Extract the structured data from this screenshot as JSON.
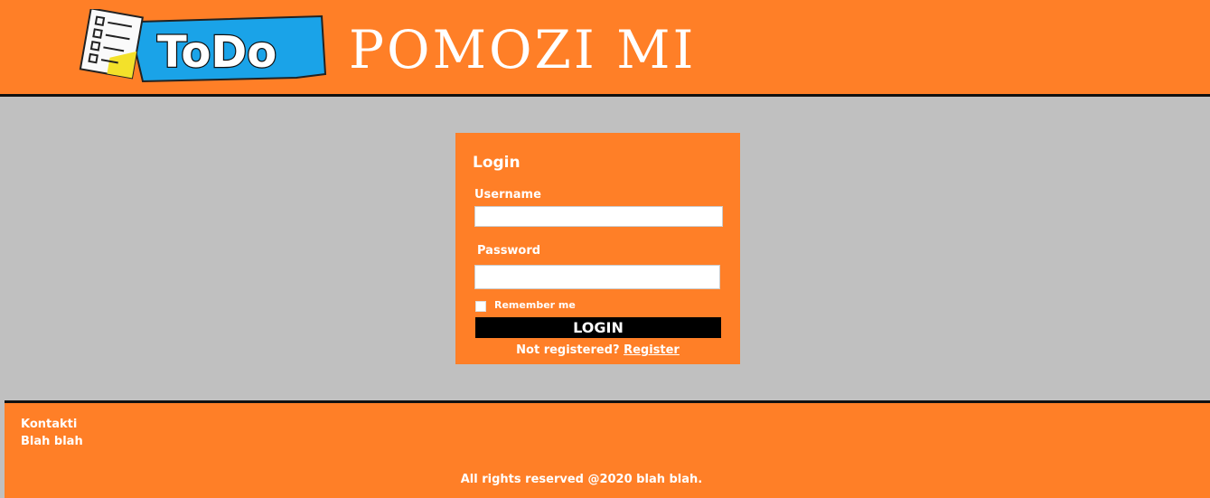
{
  "header": {
    "logo_text": "ToDo",
    "title": "POMOZI MI"
  },
  "login": {
    "title": "Login",
    "username_label": "Username",
    "username_value": "",
    "password_label": "Password",
    "password_value": "",
    "remember_label": "Remember me",
    "remember_checked": false,
    "login_button": "LOGIN",
    "not_registered_text": "Not registered?",
    "register_link": "Register"
  },
  "footer": {
    "contacts_label": "Kontakti",
    "contacts_text": "Blah blah",
    "copyright": "All rights reserved @2020 blah blah."
  },
  "colors": {
    "accent": "#ff7f27",
    "background": "#c0c0c0",
    "logo_blue": "#1aa3e8",
    "button": "#000000"
  }
}
